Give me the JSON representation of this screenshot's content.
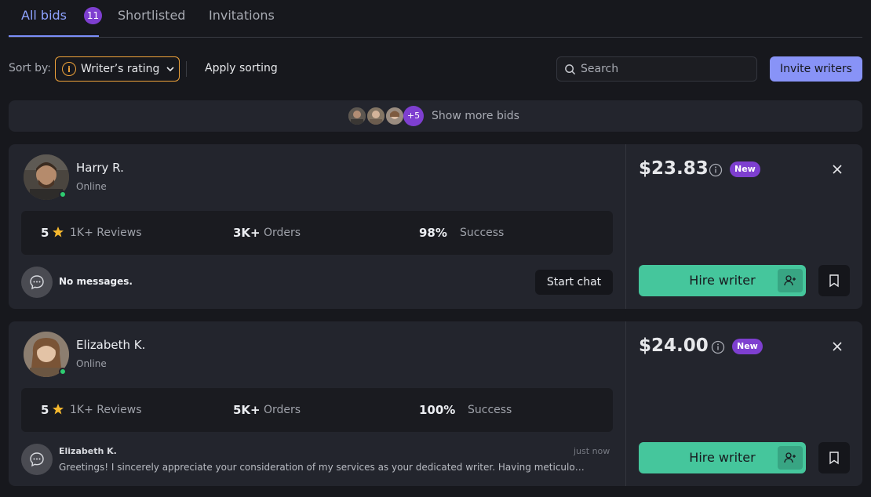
{
  "tabs": [
    {
      "label": "All bids",
      "badge": "11",
      "active": true
    },
    {
      "label": "Shortlisted",
      "active": false
    },
    {
      "label": "Invitations",
      "active": false
    }
  ],
  "toolbar": {
    "sort_label": "Sort by:",
    "sort_value": "Writer’s rating",
    "apply_sorting": "Apply sorting",
    "search_placeholder": "Search",
    "invite_label": "Invite writers"
  },
  "show_more": {
    "extra_count": "+5",
    "label": "Show more bids"
  },
  "bids": [
    {
      "name": "Harry R.",
      "status": "Online",
      "rating": "5",
      "reviews": "1K+ Reviews",
      "orders_num": "3K+",
      "orders_label": "Orders",
      "success_num": "98%",
      "success_label": "Success",
      "message": "No messages.",
      "start_chat": "Start chat",
      "price": "$23.83",
      "badge": "New",
      "hire_label": "Hire writer"
    },
    {
      "name": "Elizabeth K.",
      "status": "Online",
      "rating": "5",
      "reviews": "1K+ Reviews",
      "orders_num": "5K+",
      "orders_label": "Orders",
      "success_num": "100%",
      "success_label": "Success",
      "message_sender": "Elizabeth K.",
      "message_time": "just now",
      "message_text": "Greetings! I sincerely appreciate your consideration of my services as your dedicated writer. Having meticulou...",
      "price": "$24.00",
      "badge": "New",
      "hire_label": "Hire writer"
    }
  ],
  "colors": {
    "accent": "#8ea2ff",
    "badge_purple": "#7e3fd0",
    "hire_green": "#45c69c",
    "sort_border": "#f0a33a",
    "online": "#2ecc71"
  }
}
